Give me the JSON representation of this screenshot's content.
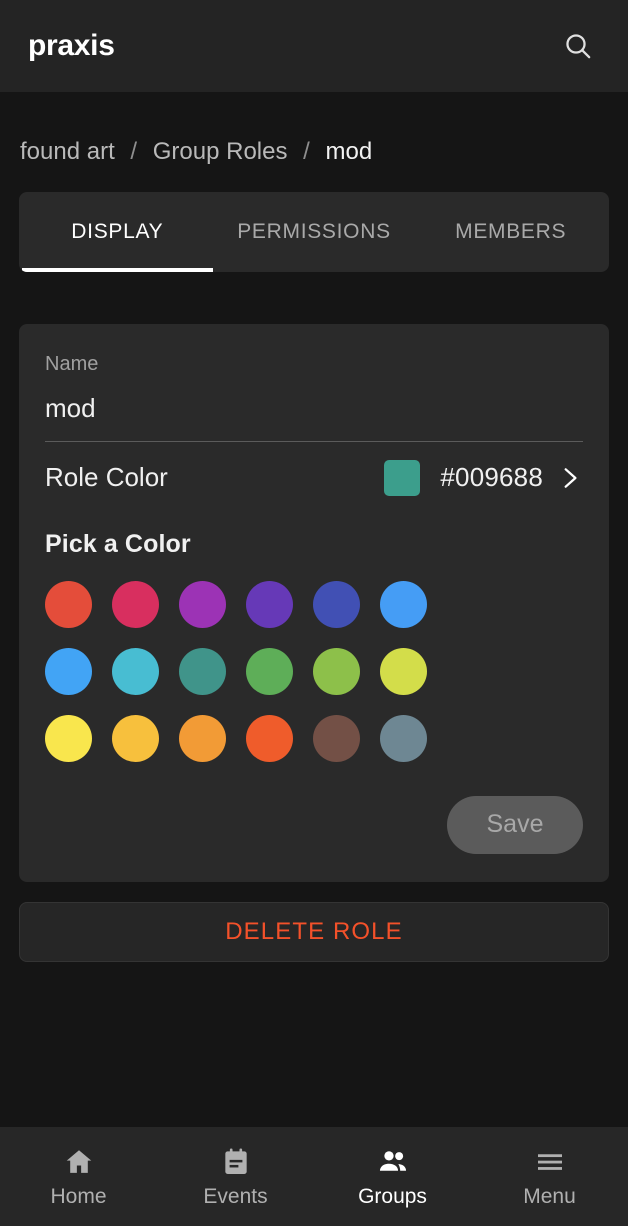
{
  "appbar": {
    "brand": "praxis",
    "search_icon": "search-icon"
  },
  "breadcrumb": {
    "items": [
      {
        "label": "found art",
        "current": false
      },
      {
        "label": "Group Roles",
        "current": false
      },
      {
        "label": "mod",
        "current": true
      }
    ],
    "separator": "/"
  },
  "tabs": [
    {
      "label": "DISPLAY",
      "active": true
    },
    {
      "label": "PERMISSIONS",
      "active": false
    },
    {
      "label": "MEMBERS",
      "active": false
    }
  ],
  "form": {
    "name_label": "Name",
    "name_value": "mod",
    "name_placeholder": "Name",
    "role_color_label": "Role Color",
    "role_color_hex": "#009688",
    "role_color_swatch": "#3c9e8c",
    "chevron_icon": "chevron-right-icon",
    "pick_a_color_title": "Pick a Color",
    "save_label": "Save",
    "save_disabled": true
  },
  "palette": {
    "rows": [
      [
        "#e44d3a",
        "#d82f5f",
        "#9c33b5",
        "#6639b7",
        "#4150b4",
        "#459df5"
      ],
      [
        "#42a4f5",
        "#48bdd2",
        "#40948a",
        "#5eae58",
        "#8dc04a",
        "#d3dd4a"
      ],
      [
        "#f9e64d",
        "#f7c03d",
        "#f29b36",
        "#ef5c2b",
        "#735046",
        "#6e8793"
      ]
    ]
  },
  "delete": {
    "label": "DELETE ROLE",
    "color": "#f4512a"
  },
  "bottomnav": [
    {
      "label": "Home",
      "icon": "home-icon",
      "active": false
    },
    {
      "label": "Events",
      "icon": "event-note-icon",
      "active": false
    },
    {
      "label": "Groups",
      "icon": "people-icon",
      "active": true
    },
    {
      "label": "Menu",
      "icon": "hamburger-menu-icon",
      "active": false
    }
  ]
}
